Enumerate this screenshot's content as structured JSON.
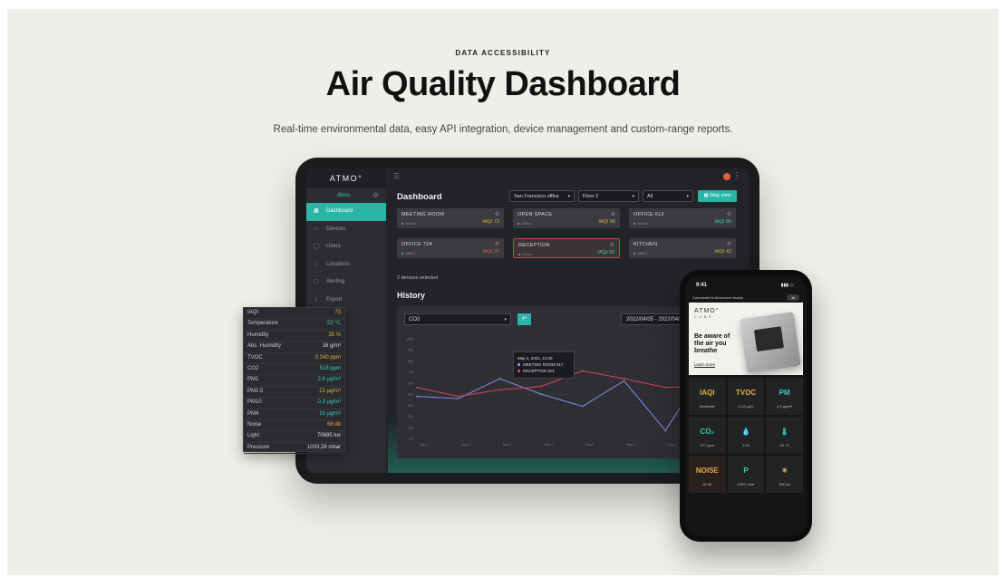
{
  "header": {
    "eyebrow": "DATA ACCESSIBILITY",
    "title": "Air Quality Dashboard",
    "subtitle": "Real-time environmental data, easy API integration, device management and custom-range reports."
  },
  "tablet": {
    "brand": "ATMO°",
    "account": "Atmo",
    "nav": [
      {
        "label": "Dashboard",
        "active": true
      },
      {
        "label": "Devices"
      },
      {
        "label": "Users"
      },
      {
        "label": "Locations"
      },
      {
        "label": "Alerting"
      },
      {
        "label": "Export"
      }
    ],
    "page_title": "Dashboard",
    "filters": {
      "office": "San Francisco office",
      "floor": "Floor 2",
      "all": "All",
      "map_view": "Map view"
    },
    "cards": [
      {
        "name": "MEETING ROOM",
        "status": "Online",
        "iaqi": "IAQI 73",
        "color": "#e0b040"
      },
      {
        "name": "OPEN SPACE",
        "status": "Online",
        "iaqi": "IAQI 68",
        "color": "#e0b040"
      },
      {
        "name": "OFFICE 512",
        "status": "Online",
        "iaqi": "IAQI 80",
        "color": "#3ccbbd"
      },
      {
        "name": "OFFICE 724",
        "status": "Offline",
        "iaqi": "IAQI 31",
        "color": "#e06a3a"
      },
      {
        "name": "RECEPTION",
        "status": "Online",
        "iaqi": "IAQI 90",
        "color": "#3ccbbd",
        "alert": true
      },
      {
        "name": "KITCHEN",
        "status": "Offline",
        "iaqi": "IAQI 42",
        "color": "#e0b040"
      }
    ],
    "selected": "2 devices selected",
    "history_title": "History",
    "history": {
      "metric": "CO2",
      "date_range": "2022/04/05 - 2022/04/11",
      "tooltip": {
        "date": "May 4, 2022, 12:00",
        "rows": [
          {
            "name": "MEETING ROOM",
            "value": "517",
            "color": "#8a86e8"
          },
          {
            "name": "RECEPTION",
            "value": "601",
            "color": "#e0405a"
          }
        ]
      }
    }
  },
  "chart_data": {
    "type": "line",
    "title": "History",
    "x": [
      "May 1",
      "May 2",
      "May 3",
      "May 4",
      "May 5",
      "May 6",
      "May 7"
    ],
    "y_ticks": [
      "1000",
      "900",
      "800",
      "700",
      "600",
      "500",
      "400",
      "300",
      "200",
      "100"
    ],
    "ylim": [
      100,
      1000
    ],
    "series": [
      {
        "name": "MEETING ROOM",
        "color": "#8a86e8",
        "values": [
          480,
          460,
          640,
          500,
          390,
          620,
          170,
          760
        ]
      },
      {
        "name": "RECEPTION",
        "color": "#e0405a",
        "values": [
          560,
          480,
          540,
          570,
          710,
          640,
          560,
          570
        ]
      }
    ]
  },
  "metrics": [
    {
      "label": "IAQI",
      "value": "73",
      "color": "#e0b040"
    },
    {
      "label": "Temperature",
      "value": "23 °C",
      "color": "#3ccbbd"
    },
    {
      "label": "Humidity",
      "value": "35 %",
      "color": "#e0b040"
    },
    {
      "label": "Abs. Humidity",
      "value": "16 g/m³",
      "color": "#dddddd"
    },
    {
      "label": "TVOC",
      "value": "0.340 ppm",
      "color": "#e0b040"
    },
    {
      "label": "CO2",
      "value": "518 ppm",
      "color": "#3ccbbd"
    },
    {
      "label": "PM1",
      "value": "2.8 µg/m³",
      "color": "#3ccbbd"
    },
    {
      "label": "PM2.5",
      "value": "21 µg/m³",
      "color": "#e0b040"
    },
    {
      "label": "PM10",
      "value": "0.3 µg/m³",
      "color": "#3ccbbd"
    },
    {
      "label": "PM4",
      "value": "19 µg/m³",
      "color": "#3ccbbd"
    },
    {
      "label": "Noise",
      "value": "68 db",
      "color": "#e0b040"
    },
    {
      "label": "Light",
      "value": "70685 lux",
      "color": "#dddddd"
    },
    {
      "label": "Pressure",
      "value": "1003.26 mbar",
      "color": "#dddddd"
    }
  ],
  "phone": {
    "time": "9:41",
    "connected": "Connected to Atmocube nearby",
    "brand": "ATMO°",
    "brand_sub": "CUBE",
    "promo": "Be aware of the air you breathe",
    "learn_more": "Learn more",
    "tiles": [
      {
        "value": "IAQI",
        "label": "Moderate",
        "color": "#e0b040"
      },
      {
        "value": "TVOC",
        "label": "0.12 ppm",
        "color": "#e0b040"
      },
      {
        "value": "PM",
        "label": "4.5 µg/m³",
        "color": "#3ccbbd"
      },
      {
        "value": "CO₂",
        "label": "577 ppm",
        "color": "#3ccbbd"
      },
      {
        "value": "💧",
        "label": "37%",
        "color": "#e06060"
      },
      {
        "value": "🌡",
        "label": "22 °C",
        "color": "#3ccbbd"
      },
      {
        "value": "NOISE",
        "label": "60 db",
        "color": "#e0b040",
        "alert": true
      },
      {
        "value": "P",
        "label": "1009 mbar",
        "color": "#3ccbbd"
      },
      {
        "value": "☀",
        "label": "395 lux",
        "color": "#e0b040"
      }
    ]
  }
}
